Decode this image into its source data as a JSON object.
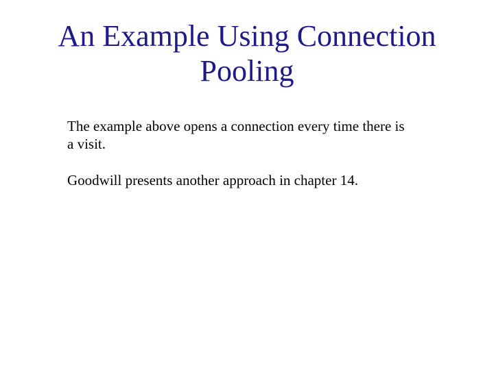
{
  "title": "An Example Using Connection Pooling",
  "paragraphs": [
    "The example above opens a connection every time there is a visit.",
    "Goodwill presents another approach in chapter 14."
  ]
}
